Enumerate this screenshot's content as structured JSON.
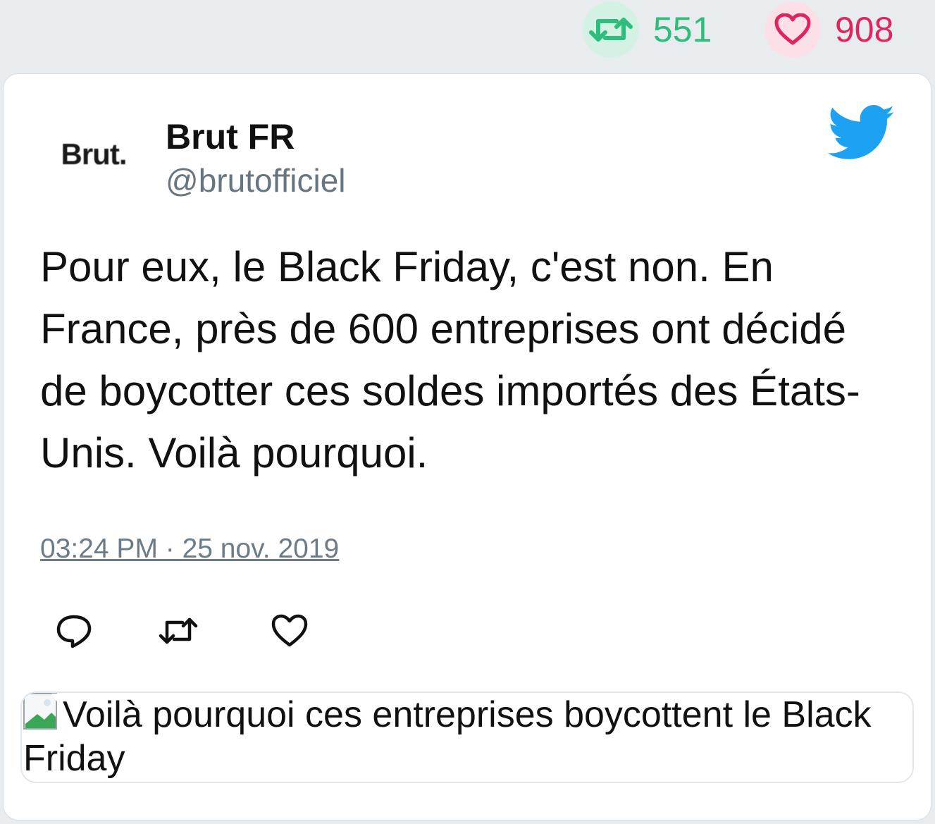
{
  "stats": {
    "retweets": "551",
    "likes": "908",
    "retweet_icon": "retweet-icon",
    "like_icon": "heart-icon",
    "retweet_color": "#2fbd7e",
    "like_color": "#e0245e"
  },
  "tweet": {
    "avatar_text": "Brut.",
    "author_name": "Brut FR",
    "author_handle": "@brutofficiel",
    "text": "Pour eux, le Black Friday, c'est non. En France, près de 600 entreprises ont décidé de boycotter ces soldes importés des États-Unis. Voilà pourquoi.",
    "timestamp": "03:24 PM · 25 nov. 2019",
    "brand_icon": "twitter-bird-icon",
    "brand_color": "#1da1f2",
    "actions": [
      "reply-icon",
      "retweet-icon",
      "heart-icon"
    ],
    "media_alt": "Voilà pourquoi ces entreprises boycottent le Black Friday"
  }
}
